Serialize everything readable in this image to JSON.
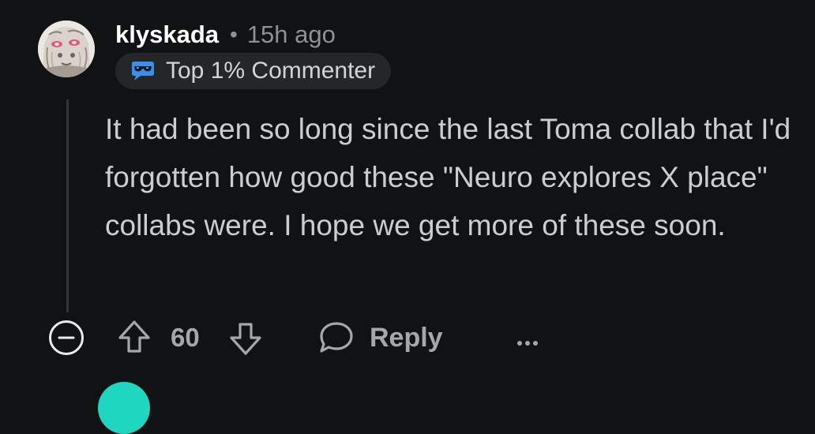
{
  "comment": {
    "username": "klyskada",
    "separator": "•",
    "timestamp": "15h ago",
    "flair": {
      "icon": "sunglasses-chat-icon",
      "label": "Top 1% Commenter"
    },
    "body": "It had been so long since the last Toma collab that I'd forgotten how good these \"Neuro explores X place\" collabs were. I hope we get more of these soon.",
    "score": "60",
    "reply_label": "Reply"
  },
  "icons": {
    "collapse": "collapse-minus-icon",
    "upvote": "upvote-arrow-icon",
    "downvote": "downvote-arrow-icon",
    "reply": "speech-bubble-icon",
    "more": "more-options-icon"
  },
  "colors": {
    "background": "#111213",
    "username": "#ffffff",
    "meta": "#8d9296",
    "body_text": "#c9ced2",
    "action_text": "#a3a8ad",
    "flair_bg": "#252627",
    "flair_icon": "#3c8fe8",
    "thread_line": "#343536",
    "next_avatar": "#1fd7c1"
  }
}
